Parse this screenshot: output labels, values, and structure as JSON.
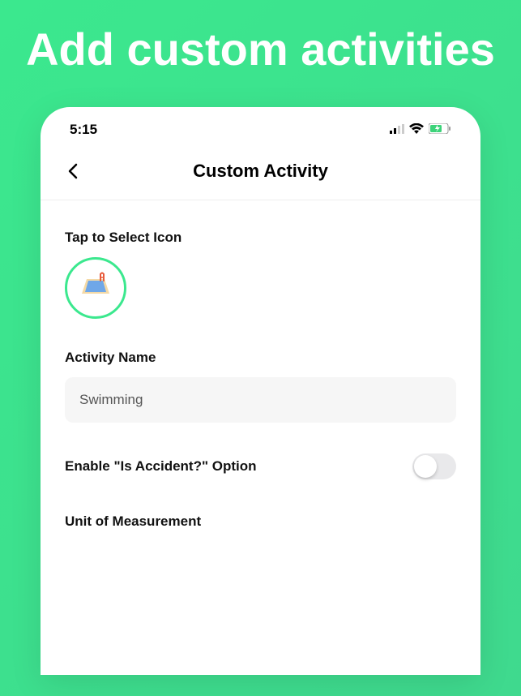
{
  "hero": {
    "title": "Add custom activities"
  },
  "status_bar": {
    "time": "5:15"
  },
  "nav": {
    "title": "Custom Activity"
  },
  "form": {
    "icon_label": "Tap to Select Icon",
    "icon_name": "pool-icon",
    "name_label": "Activity Name",
    "name_value": "Swimming",
    "accident_label": "Enable \"Is Accident?\" Option",
    "accident_enabled": false,
    "unit_label": "Unit of Measurement"
  }
}
